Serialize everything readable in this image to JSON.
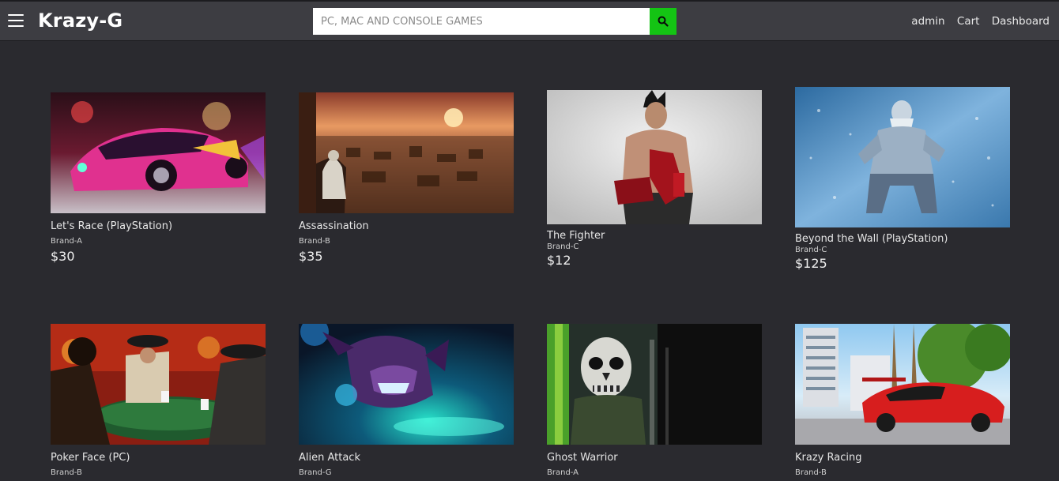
{
  "header": {
    "brand": "Krazy-G",
    "search_placeholder": "PC, MAC AND CONSOLE GAMES",
    "links": [
      "admin",
      "Cart",
      "Dashboard"
    ]
  },
  "products": [
    {
      "title": "Let's Race (PlayStation)",
      "brand": "Brand-A",
      "price": "$30"
    },
    {
      "title": "Assassination",
      "brand": "Brand-B",
      "price": "$35"
    },
    {
      "title": "The Fighter",
      "brand": "Brand-C",
      "price": "$12"
    },
    {
      "title": "Beyond the Wall (PlayStation)",
      "brand": "Brand-C",
      "price": "$125"
    },
    {
      "title": "Poker Face (PC)",
      "brand": "Brand-B",
      "price": ""
    },
    {
      "title": "Alien Attack",
      "brand": "Brand-G",
      "price": ""
    },
    {
      "title": "Ghost Warrior",
      "brand": "Brand-A",
      "price": ""
    },
    {
      "title": "Krazy Racing",
      "brand": "Brand-B",
      "price": ""
    }
  ],
  "colors": {
    "background": "#2a2a2f",
    "navbar": "#3d3d42",
    "search_button": "#14c414"
  },
  "icons": {
    "menu": "hamburger-menu-icon",
    "search": "search-icon"
  }
}
